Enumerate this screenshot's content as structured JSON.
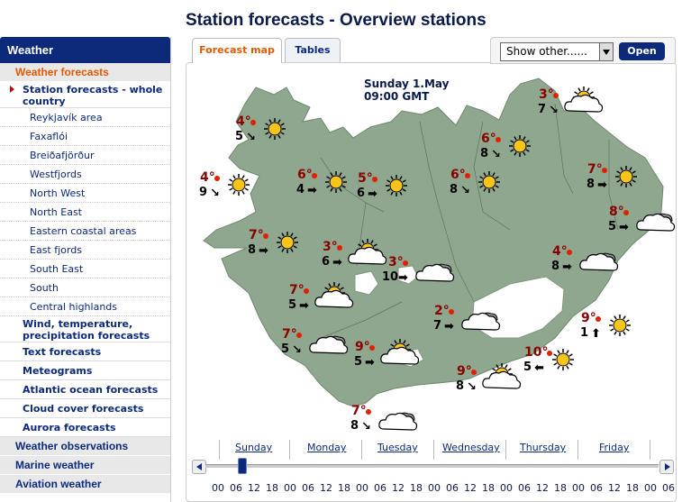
{
  "page_title": "Station forecasts - Overview stations",
  "sidebar": {
    "header": "Weather",
    "active_section": "Weather forecasts",
    "selected_item": "Station forecasts - whole country",
    "sub_items": [
      "Reykjavík area",
      "Faxaflói",
      "Breiðafjörður",
      "Westfjords",
      "North West",
      "North East",
      "Eastern coastal areas",
      "East fjords",
      "South East",
      "South",
      "Central highlands"
    ],
    "items": [
      "Wind, temperature, precipitation forecasts",
      "Text forecasts",
      "Meteograms",
      "Atlantic ocean forecasts",
      "Cloud cover forecasts",
      "Aurora forecasts"
    ],
    "sections": [
      "Weather observations",
      "Marine weather",
      "Aviation weather"
    ]
  },
  "tabs": {
    "map": "Forecast map",
    "tables": "Tables"
  },
  "controls": {
    "show_other": "Show other......",
    "open": "Open"
  },
  "map": {
    "date": "Sunday 1.May",
    "time": "09:00 GMT",
    "stations": [
      {
        "temp": "4°",
        "wind": "5",
        "dir": "↘",
        "wx": "sun"
      },
      {
        "temp": "4°",
        "wind": "9",
        "dir": "↘",
        "wx": "sun"
      },
      {
        "temp": "6°",
        "wind": "4",
        "dir": "➡",
        "wx": "sun"
      },
      {
        "temp": "5°",
        "wind": "6",
        "dir": "➡",
        "wx": "sun"
      },
      {
        "temp": "6°",
        "wind": "8",
        "dir": "↘",
        "wx": "sun"
      },
      {
        "temp": "6°",
        "wind": "8",
        "dir": "↘",
        "wx": "sun"
      },
      {
        "temp": "3°",
        "wind": "7",
        "dir": "↘",
        "wx": "partly"
      },
      {
        "temp": "7°",
        "wind": "8",
        "dir": "➡",
        "wx": "sun"
      },
      {
        "temp": "8°",
        "wind": "5",
        "dir": "➡",
        "wx": "cloud"
      },
      {
        "temp": "7°",
        "wind": "8",
        "dir": "➡",
        "wx": "sun"
      },
      {
        "temp": "3°",
        "wind": "6",
        "dir": "➡",
        "wx": "partly"
      },
      {
        "temp": "3°",
        "wind": "10",
        "dir": "➡",
        "wx": "cloud"
      },
      {
        "temp": "4°",
        "wind": "8",
        "dir": "➡",
        "wx": "cloud"
      },
      {
        "temp": "7°",
        "wind": "5",
        "dir": "➡",
        "wx": "partly"
      },
      {
        "temp": "2°",
        "wind": "7",
        "dir": "➡",
        "wx": "cloud"
      },
      {
        "temp": "9°",
        "wind": "1",
        "dir": "⬆",
        "wx": "sun"
      },
      {
        "temp": "7°",
        "wind": "5",
        "dir": "↘",
        "wx": "cloud"
      },
      {
        "temp": "9°",
        "wind": "5",
        "dir": "➡",
        "wx": "partly"
      },
      {
        "temp": "10°",
        "wind": "5",
        "dir": "⬅",
        "wx": "sun"
      },
      {
        "temp": "9°",
        "wind": "8",
        "dir": "↘",
        "wx": "partly"
      },
      {
        "temp": "7°",
        "wind": "8",
        "dir": "↘",
        "wx": "cloud"
      }
    ]
  },
  "timeline": {
    "days": [
      "Sunday",
      "Monday",
      "Tuesday",
      "Wednesday",
      "Thursday",
      "Friday"
    ],
    "hours": [
      "00",
      "06",
      "12",
      "18",
      "00",
      "06",
      "12",
      "18",
      "00",
      "06",
      "12",
      "18",
      "00",
      "06",
      "12",
      "18",
      "00",
      "06",
      "12",
      "18",
      "00",
      "06",
      "12",
      "18",
      "00",
      "06"
    ],
    "selected_hour": "09"
  },
  "colors": {
    "accent": "#e05a00",
    "brand": "#0d2a7a",
    "land": "#8fa78f",
    "temp": "#8a0000"
  }
}
